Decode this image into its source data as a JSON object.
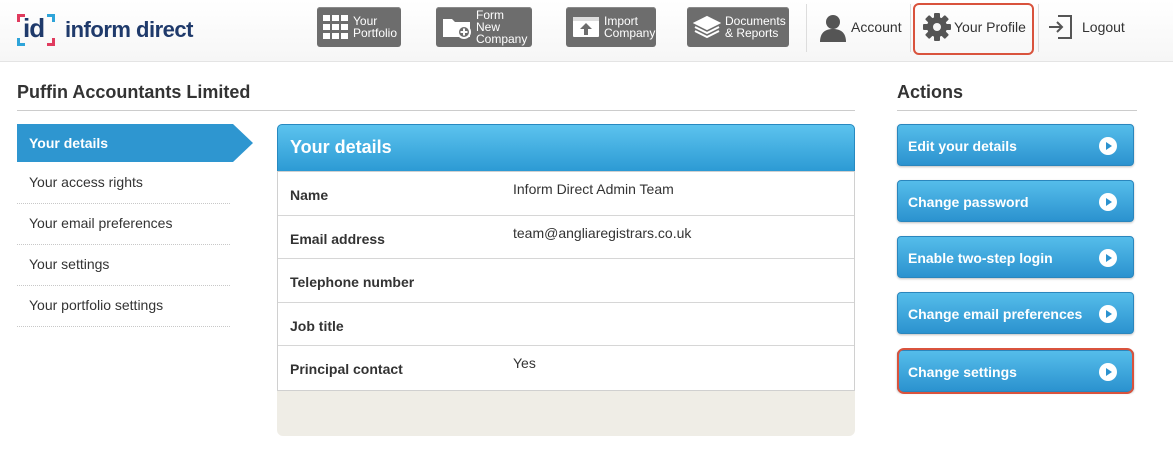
{
  "brand": {
    "logo_mark": "id",
    "name": "inform direct"
  },
  "nav": {
    "portfolio": "Your\nPortfolio",
    "form_company": "Form New\nCompany",
    "import_company": "Import\nCompany",
    "documents": "Documents\n& Reports"
  },
  "top_links": {
    "account": "Account",
    "profile": "Your Profile",
    "logout": "Logout"
  },
  "company_name": "Puffin Accountants Limited",
  "sidebar": {
    "active": "Your details",
    "items": [
      {
        "label": "Your access rights"
      },
      {
        "label": "Your email preferences"
      },
      {
        "label": "Your settings"
      },
      {
        "label": "Your portfolio settings"
      }
    ]
  },
  "details": {
    "title": "Your details",
    "rows": [
      {
        "label": "Name",
        "value": "Inform Direct Admin Team"
      },
      {
        "label": "Email address",
        "value": "team@angliaregistrars.co.uk"
      },
      {
        "label": "Telephone number",
        "value": ""
      },
      {
        "label": "Job title",
        "value": ""
      },
      {
        "label": "Principal contact",
        "value": "Yes"
      }
    ]
  },
  "actions": {
    "title": "Actions",
    "buttons": [
      {
        "label": "Edit your details"
      },
      {
        "label": "Change password"
      },
      {
        "label": "Enable two-step login"
      },
      {
        "label": "Change email preferences"
      },
      {
        "label": "Change settings"
      }
    ]
  },
  "colors": {
    "accent_blue": "#2c9ad4",
    "highlight_red": "#d9533d",
    "nav_gray": "#6d6d6d",
    "brand_navy": "#1f3a6b"
  }
}
